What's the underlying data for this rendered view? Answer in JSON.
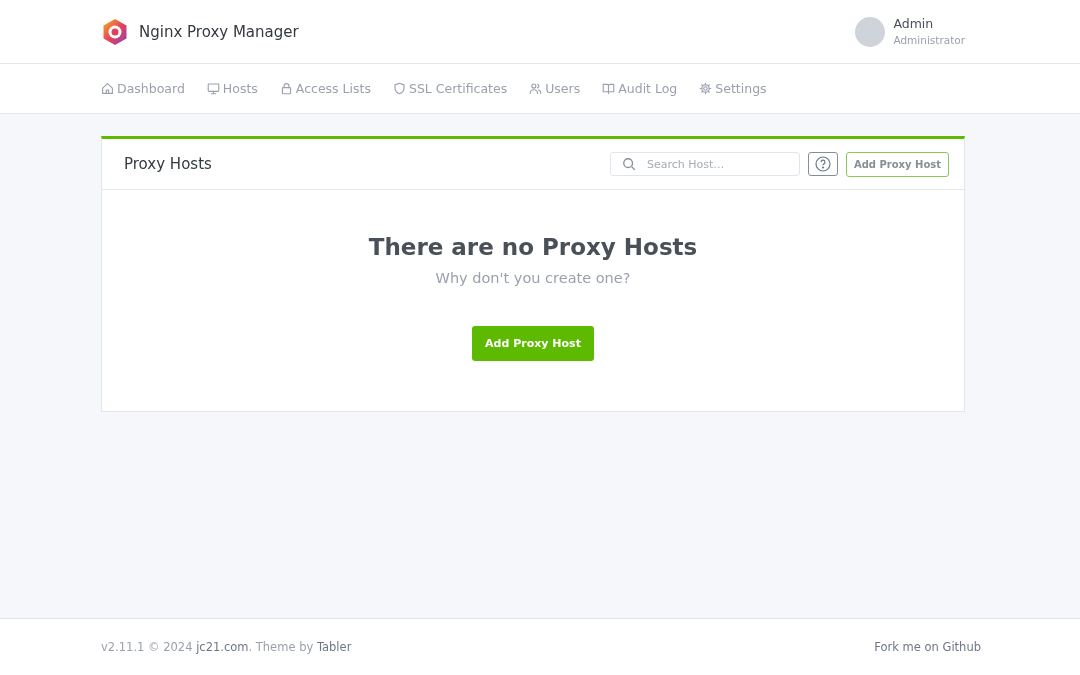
{
  "brand": {
    "title": "Nginx Proxy Manager"
  },
  "user": {
    "name": "Admin",
    "role": "Administrator"
  },
  "nav": [
    {
      "label": "Dashboard"
    },
    {
      "label": "Hosts"
    },
    {
      "label": "Access Lists"
    },
    {
      "label": "SSL Certificates"
    },
    {
      "label": "Users"
    },
    {
      "label": "Audit Log"
    },
    {
      "label": "Settings"
    }
  ],
  "card": {
    "title": "Proxy Hosts",
    "search": {
      "placeholder": "Search Host…"
    },
    "add_button": "Add Proxy Host",
    "empty": {
      "heading": "There are no Proxy Hosts",
      "subtitle": "Why don't you create one?",
      "button": "Add Proxy Host"
    }
  },
  "footer": {
    "text_before": "v2.11.1 © 2024 ",
    "link_1": "jc21.com",
    "text_middle": ". Theme by ",
    "link_2": "Tabler",
    "fork_link": "Fork me on Github"
  }
}
